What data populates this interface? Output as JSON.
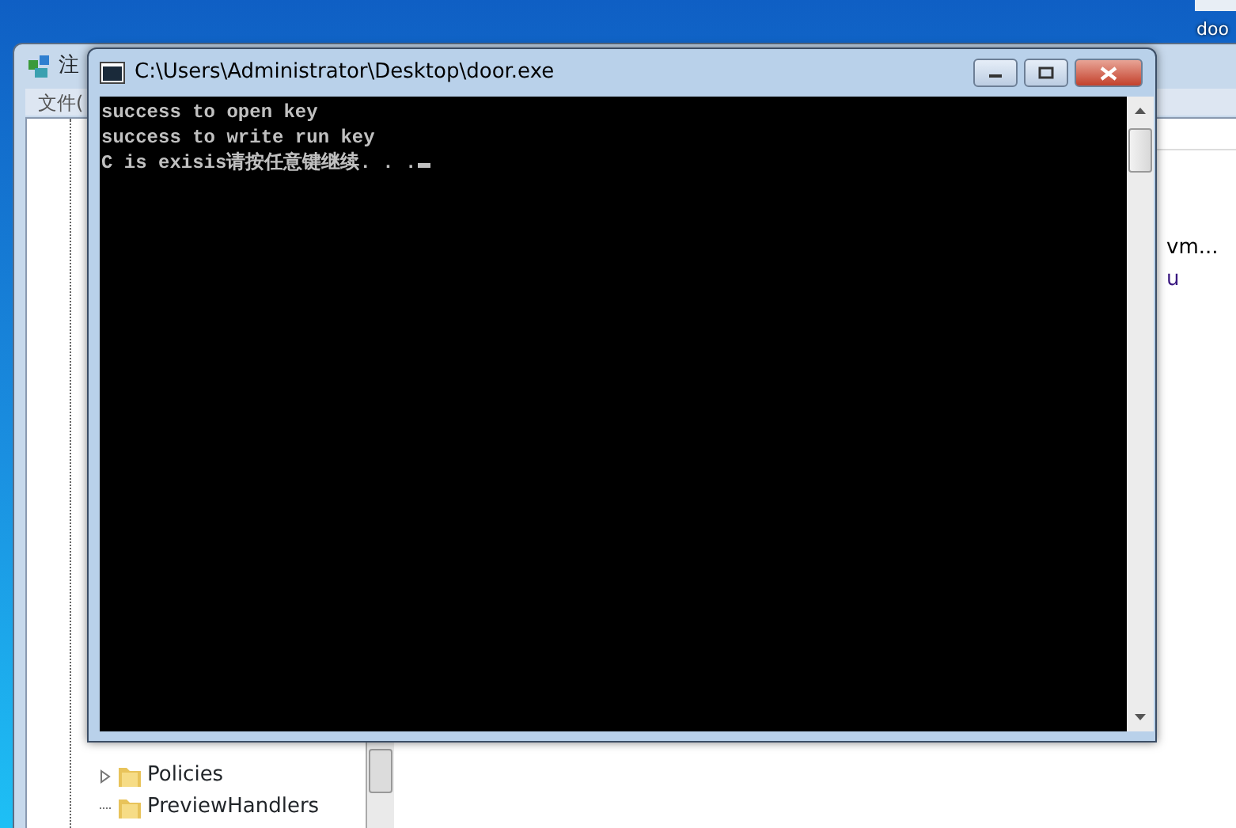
{
  "desktop": {
    "icon_label": "doo"
  },
  "background_window": {
    "title": "注",
    "menu": [
      "文件("
    ],
    "tree": [
      {
        "label": "Policies",
        "expandable": true
      },
      {
        "label": "PreviewHandlers",
        "expandable": false
      }
    ],
    "list_items": [
      "vm...",
      "u"
    ]
  },
  "console": {
    "title": "C:\\Users\\Administrator\\Desktop\\door.exe",
    "lines": [
      "success to open key",
      "success to write run key",
      "C is exisis请按任意键继续. . . "
    ],
    "cursor": true
  }
}
